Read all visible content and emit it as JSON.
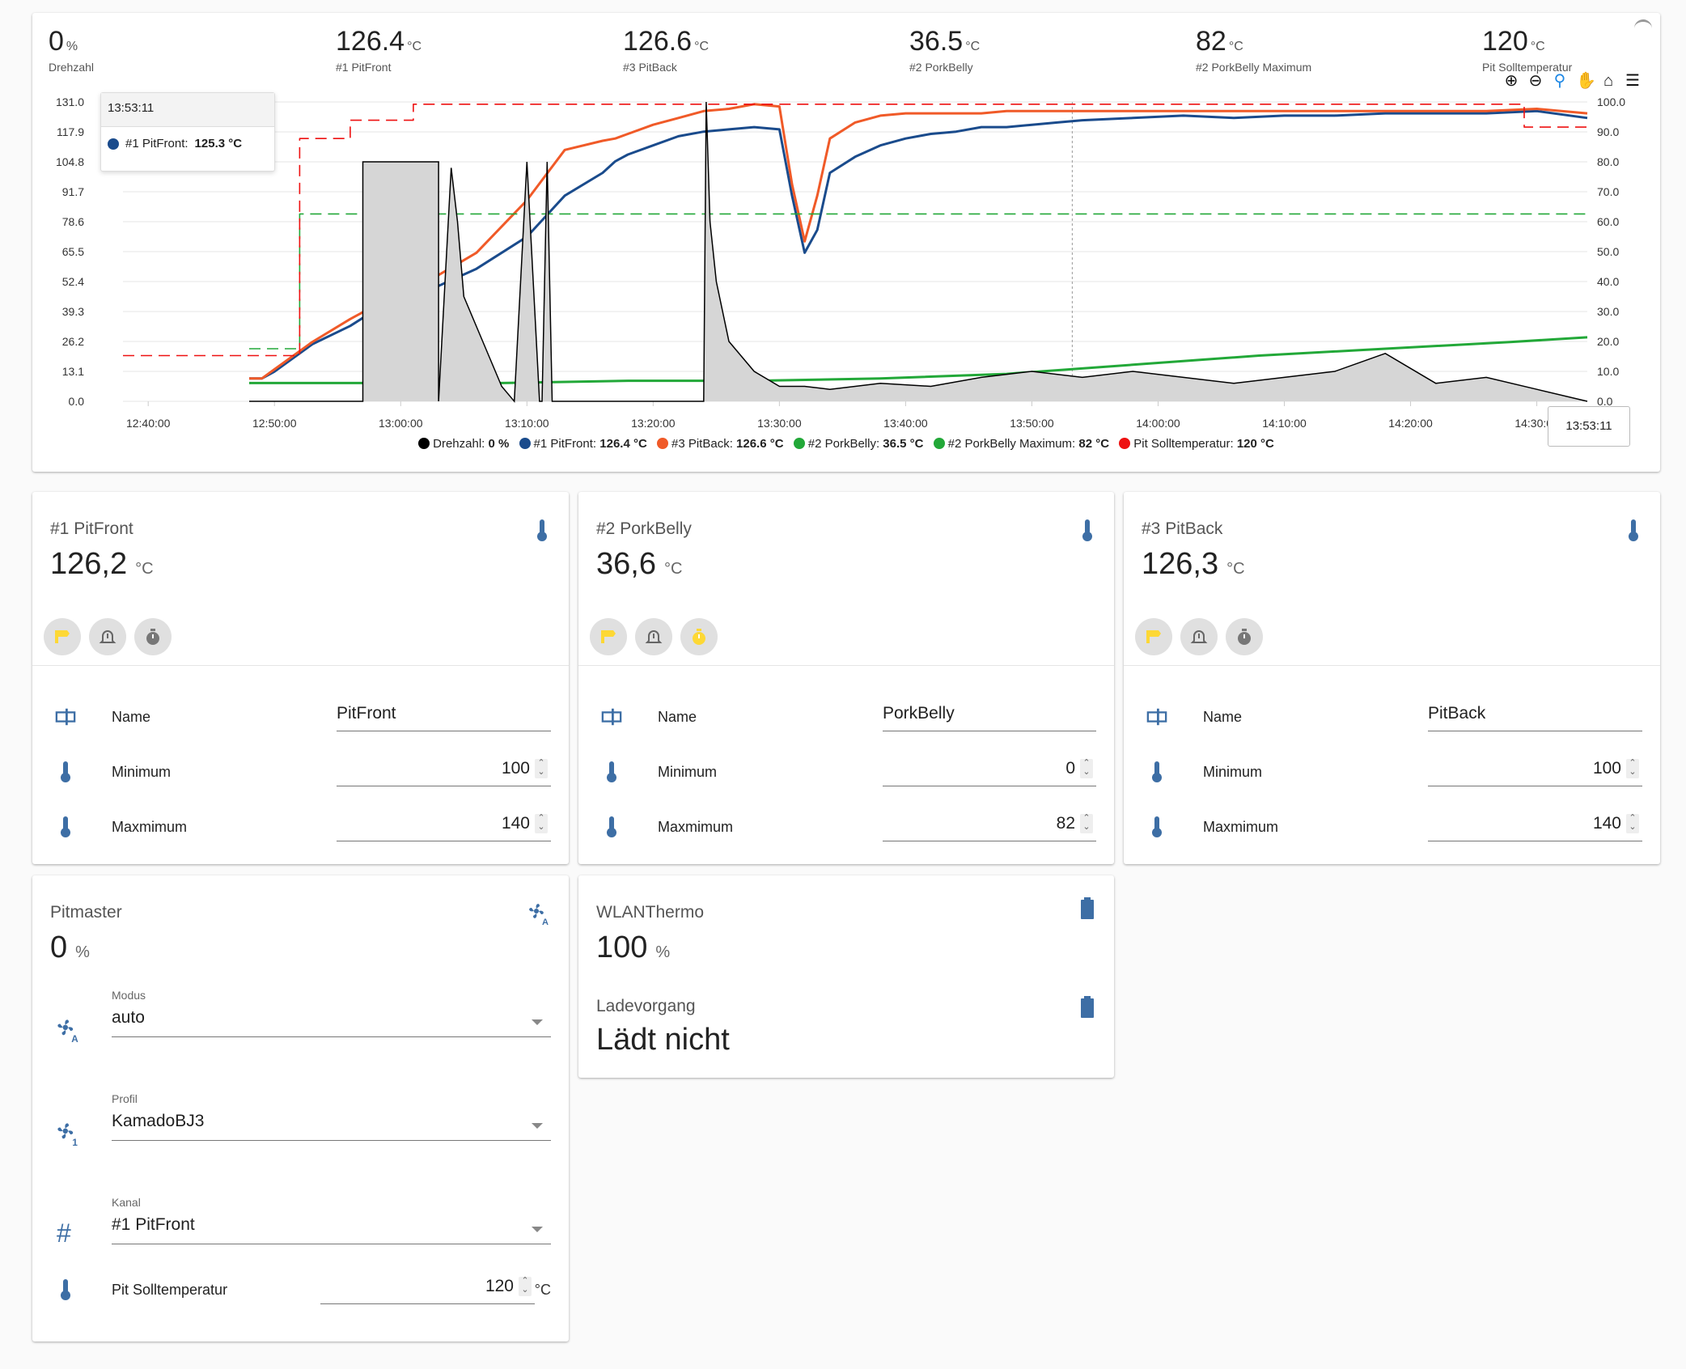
{
  "header_stats": [
    {
      "value": "0",
      "unit": "%",
      "label": "Drehzahl"
    },
    {
      "value": "126.4",
      "unit": "°C",
      "label": "#1 PitFront"
    },
    {
      "value": "126.6",
      "unit": "°C",
      "label": "#3 PitBack"
    },
    {
      "value": "36.5",
      "unit": "°C",
      "label": "#2 PorkBelly"
    },
    {
      "value": "82",
      "unit": "°C",
      "label": "#2 PorkBelly Maximum"
    },
    {
      "value": "120",
      "unit": "°C",
      "label": "Pit Solltemperatur"
    }
  ],
  "toolbar": {
    "icons": [
      "zoom-in-icon",
      "zoom-out-icon",
      "selection-zoom-icon",
      "pan-icon",
      "home-icon",
      "menu-icon"
    ]
  },
  "tooltip": {
    "time": "13:53:11",
    "series": "#1 PitFront:",
    "value": "125.3 °C"
  },
  "crosshair_label": "13:53:11",
  "legend": [
    {
      "name": "Drehzahl:",
      "value": "0 %",
      "color": "#000000"
    },
    {
      "name": "#1 PitFront:",
      "value": "126.4 °C",
      "color": "#1a4b8c"
    },
    {
      "name": "#3 PitBack:",
      "value": "126.6 °C",
      "color": "#f05a28"
    },
    {
      "name": "#2 PorkBelly:",
      "value": "36.5 °C",
      "color": "#22a838"
    },
    {
      "name": "#2 PorkBelly Maximum:",
      "value": "82 °C",
      "color": "#22a838"
    },
    {
      "name": "Pit Solltemperatur:",
      "value": "120 °C",
      "color": "#ee1111"
    }
  ],
  "chart_data": {
    "type": "line",
    "x_ticks": [
      "12:40:00",
      "12:50:00",
      "13:00:00",
      "13:10:00",
      "13:20:00",
      "13:30:00",
      "13:40:00",
      "13:50:00",
      "14:00:00",
      "14:10:00",
      "14:20:00",
      "14:30:00"
    ],
    "y_left_ticks": [
      "131.0",
      "117.9",
      "104.8",
      "91.7",
      "78.6",
      "65.5",
      "52.4",
      "39.3",
      "26.2",
      "13.1",
      "0.0"
    ],
    "y_right_ticks": [
      "100.0",
      "90.0",
      "80.0",
      "70.0",
      "60.0",
      "50.0",
      "40.0",
      "30.0",
      "20.0",
      "10.0",
      "0.0"
    ],
    "x_min_minutes": 0,
    "x_max_minutes": 116,
    "y_left_range": [
      0,
      131
    ],
    "y_right_range": [
      0,
      100
    ],
    "x_unit": "minutes after 12:38:00",
    "series": [
      {
        "name": "#1 PitFront",
        "color": "#1a4b8c",
        "axis": "left",
        "x": [
          10,
          11,
          12,
          15,
          18,
          20,
          24,
          28,
          32,
          35,
          38,
          39,
          40,
          42,
          44,
          46,
          48,
          50,
          52,
          53,
          54,
          55,
          56,
          58,
          60,
          62,
          64,
          66,
          68,
          70,
          72,
          74,
          76,
          80,
          84,
          88,
          92,
          96,
          100,
          104,
          108,
          112,
          116
        ],
        "y": [
          10,
          10,
          13,
          25,
          33,
          40,
          48,
          58,
          72,
          90,
          100,
          105,
          108,
          112,
          116,
          118,
          119,
          120,
          119,
          90,
          65,
          75,
          100,
          107,
          112,
          115,
          117,
          118,
          120,
          120,
          121,
          122,
          123,
          124,
          125,
          124,
          125,
          125,
          126,
          126,
          126,
          127,
          124
        ]
      },
      {
        "name": "#3 PitBack",
        "color": "#f05a28",
        "axis": "left",
        "x": [
          10,
          11,
          12,
          15,
          18,
          20,
          24,
          28,
          32,
          35,
          38,
          39,
          40,
          42,
          44,
          46,
          48,
          50,
          52,
          53,
          54,
          55,
          56,
          58,
          60,
          62,
          64,
          66,
          68,
          70,
          72,
          74,
          76,
          80,
          84,
          88,
          92,
          96,
          100,
          104,
          108,
          112,
          116
        ],
        "y": [
          10,
          10,
          14,
          26,
          36,
          42,
          52,
          65,
          88,
          110,
          114,
          115,
          117,
          121,
          124,
          127,
          128,
          130,
          129,
          95,
          70,
          90,
          115,
          122,
          125,
          126,
          126,
          126,
          126,
          127,
          127,
          127,
          127,
          127,
          127,
          127,
          127,
          127,
          127,
          127,
          127,
          128,
          126
        ]
      },
      {
        "name": "#2 PorkBelly",
        "color": "#22a838",
        "axis": "left",
        "x": [
          10,
          20,
          30,
          40,
          50,
          60,
          70,
          80,
          90,
          100,
          110,
          116
        ],
        "y": [
          8,
          8,
          8,
          9,
          9,
          10,
          12,
          16,
          20,
          23,
          26,
          28
        ]
      },
      {
        "name": "#2 PorkBelly Maximum",
        "color": "#22a838",
        "axis": "left",
        "dashed": true,
        "x": [
          10,
          13,
          13.3,
          14,
          14,
          116
        ],
        "y": [
          23,
          23,
          23,
          23,
          82,
          82
        ]
      },
      {
        "name": "Pit Solltemperatur",
        "color": "#ee1111",
        "axis": "left",
        "dashed": true,
        "x": [
          0,
          14,
          14,
          18,
          18,
          23,
          23,
          111,
          111,
          116
        ],
        "y": [
          20,
          20,
          115,
          115,
          123,
          123,
          130,
          130,
          120,
          120
        ]
      },
      {
        "name": "Drehzahl",
        "color": "#000000",
        "axis": "right",
        "area": true,
        "x": [
          10,
          19,
          19,
          20,
          24,
          25,
          25,
          26,
          26.5,
          27,
          28,
          29,
          30,
          31,
          32,
          33,
          33.2,
          33.6,
          34,
          36,
          36.2,
          36.4,
          38,
          40,
          46,
          46.2,
          46.5,
          47,
          48,
          50,
          52,
          54,
          56,
          60,
          64,
          68,
          72,
          76,
          80,
          84,
          88,
          92,
          96,
          100,
          104,
          108,
          112,
          116
        ],
        "y": [
          0,
          0,
          80,
          80,
          80,
          80,
          0,
          78,
          60,
          35,
          25,
          15,
          5,
          0,
          80,
          0,
          0,
          80,
          0,
          0,
          0,
          0,
          0,
          0,
          0,
          100,
          60,
          40,
          20,
          10,
          5,
          5,
          4,
          6,
          5,
          8,
          10,
          8,
          10,
          8,
          6,
          8,
          10,
          16,
          6,
          8,
          4,
          0
        ]
      }
    ]
  },
  "channels": [
    {
      "title": "#1 PitFront",
      "value": "126,2",
      "unit": "°C",
      "timer_active": false,
      "name_label": "Name",
      "name_value": "PitFront",
      "min_label": "Minimum",
      "min_value": "100",
      "max_label": "Maxmimum",
      "max_value": "140"
    },
    {
      "title": "#2 PorkBelly",
      "value": "36,6",
      "unit": "°C",
      "timer_active": true,
      "name_label": "Name",
      "name_value": "PorkBelly",
      "min_label": "Minimum",
      "min_value": "0",
      "max_label": "Maxmimum",
      "max_value": "82"
    },
    {
      "title": "#3 PitBack",
      "value": "126,3",
      "unit": "°C",
      "timer_active": false,
      "name_label": "Name",
      "name_value": "PitBack",
      "min_label": "Minimum",
      "min_value": "100",
      "max_label": "Maxmimum",
      "max_value": "140"
    }
  ],
  "pitmaster": {
    "title": "Pitmaster",
    "value": "0",
    "unit": "%",
    "modus_label": "Modus",
    "modus_value": "auto",
    "profil_label": "Profil",
    "profil_value": "KamadoBJ3",
    "kanal_label": "Kanal",
    "kanal_value": "#1 PitFront",
    "soll_label": "Pit Solltemperatur",
    "soll_value": "120",
    "soll_unit": "°C"
  },
  "wlanthermo": {
    "title": "WLANThermo",
    "value": "100",
    "unit": "%",
    "charge_label": "Ladevorgang",
    "charge_value": "Lädt nicht"
  },
  "colors": {
    "accent_blue": "#3d6ea5",
    "yellow": "#fdd835",
    "grey_btn": "#e0e0e0"
  }
}
